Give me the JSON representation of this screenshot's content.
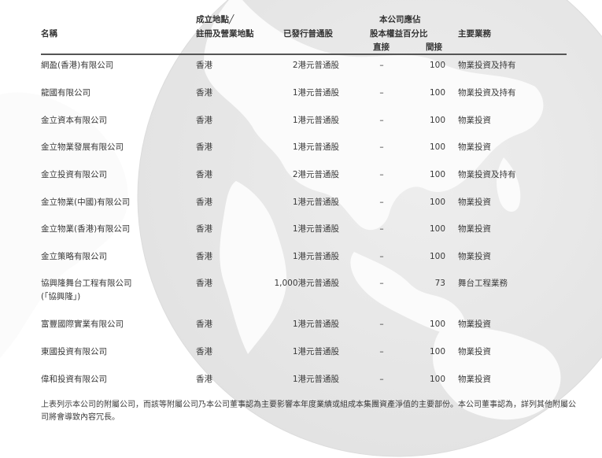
{
  "table": {
    "headers": {
      "name": "名稱",
      "place_line1": "成立地點╱",
      "place_line2": "註冊及營業地點",
      "shares": "已發行普通股",
      "interest_line1": "本公司應佔",
      "interest_line2": "股本權益百分比",
      "direct": "直接",
      "indirect": "間接",
      "business": "主要業務"
    },
    "rows": [
      {
        "name": "網盈(香港)有限公司",
        "name2": "",
        "place": "香港",
        "shares": "2港元普通股",
        "direct": "–",
        "indirect": "100",
        "business": "物業投資及持有"
      },
      {
        "name": "龍國有限公司",
        "name2": "",
        "place": "香港",
        "shares": "1港元普通股",
        "direct": "–",
        "indirect": "100",
        "business": "物業投資及持有"
      },
      {
        "name": "金立資本有限公司",
        "name2": "",
        "place": "香港",
        "shares": "1港元普通股",
        "direct": "–",
        "indirect": "100",
        "business": "物業投資"
      },
      {
        "name": "金立物業發展有限公司",
        "name2": "",
        "place": "香港",
        "shares": "1港元普通股",
        "direct": "–",
        "indirect": "100",
        "business": "物業投資"
      },
      {
        "name": "金立投資有限公司",
        "name2": "",
        "place": "香港",
        "shares": "2港元普通股",
        "direct": "–",
        "indirect": "100",
        "business": "物業投資及持有"
      },
      {
        "name": "金立物業(中國)有限公司",
        "name2": "",
        "place": "香港",
        "shares": "1港元普通股",
        "direct": "–",
        "indirect": "100",
        "business": "物業投資"
      },
      {
        "name": "金立物業(香港)有限公司",
        "name2": "",
        "place": "香港",
        "shares": "1港元普通股",
        "direct": "–",
        "indirect": "100",
        "business": "物業投資"
      },
      {
        "name": "金立策略有限公司",
        "name2": "",
        "place": "香港",
        "shares": "1港元普通股",
        "direct": "–",
        "indirect": "100",
        "business": "物業投資"
      },
      {
        "name": "協興隆舞台工程有限公司",
        "name2": "(「協興隆」)",
        "place": "香港",
        "shares": "1,000港元普通股",
        "direct": "–",
        "indirect": "73",
        "business": "舞台工程業務"
      },
      {
        "name": "富豐國際實業有限公司",
        "name2": "",
        "place": "香港",
        "shares": "1港元普通股",
        "direct": "–",
        "indirect": "100",
        "business": "物業投資"
      },
      {
        "name": "東國投資有限公司",
        "name2": "",
        "place": "香港",
        "shares": "1港元普通股",
        "direct": "–",
        "indirect": "100",
        "business": "物業投資"
      },
      {
        "name": "偉和投資有限公司",
        "name2": "",
        "place": "香港",
        "shares": "1港元普通股",
        "direct": "–",
        "indirect": "100",
        "business": "物業投資"
      }
    ]
  },
  "footnote": "上表列示本公司的附屬公司，而該等附屬公司乃本公司董事認為主要影響本年度業績或組成本集團資產淨值的主要部份。本公司董事認為，詳列其他附屬公司將會導致內容冗長。"
}
